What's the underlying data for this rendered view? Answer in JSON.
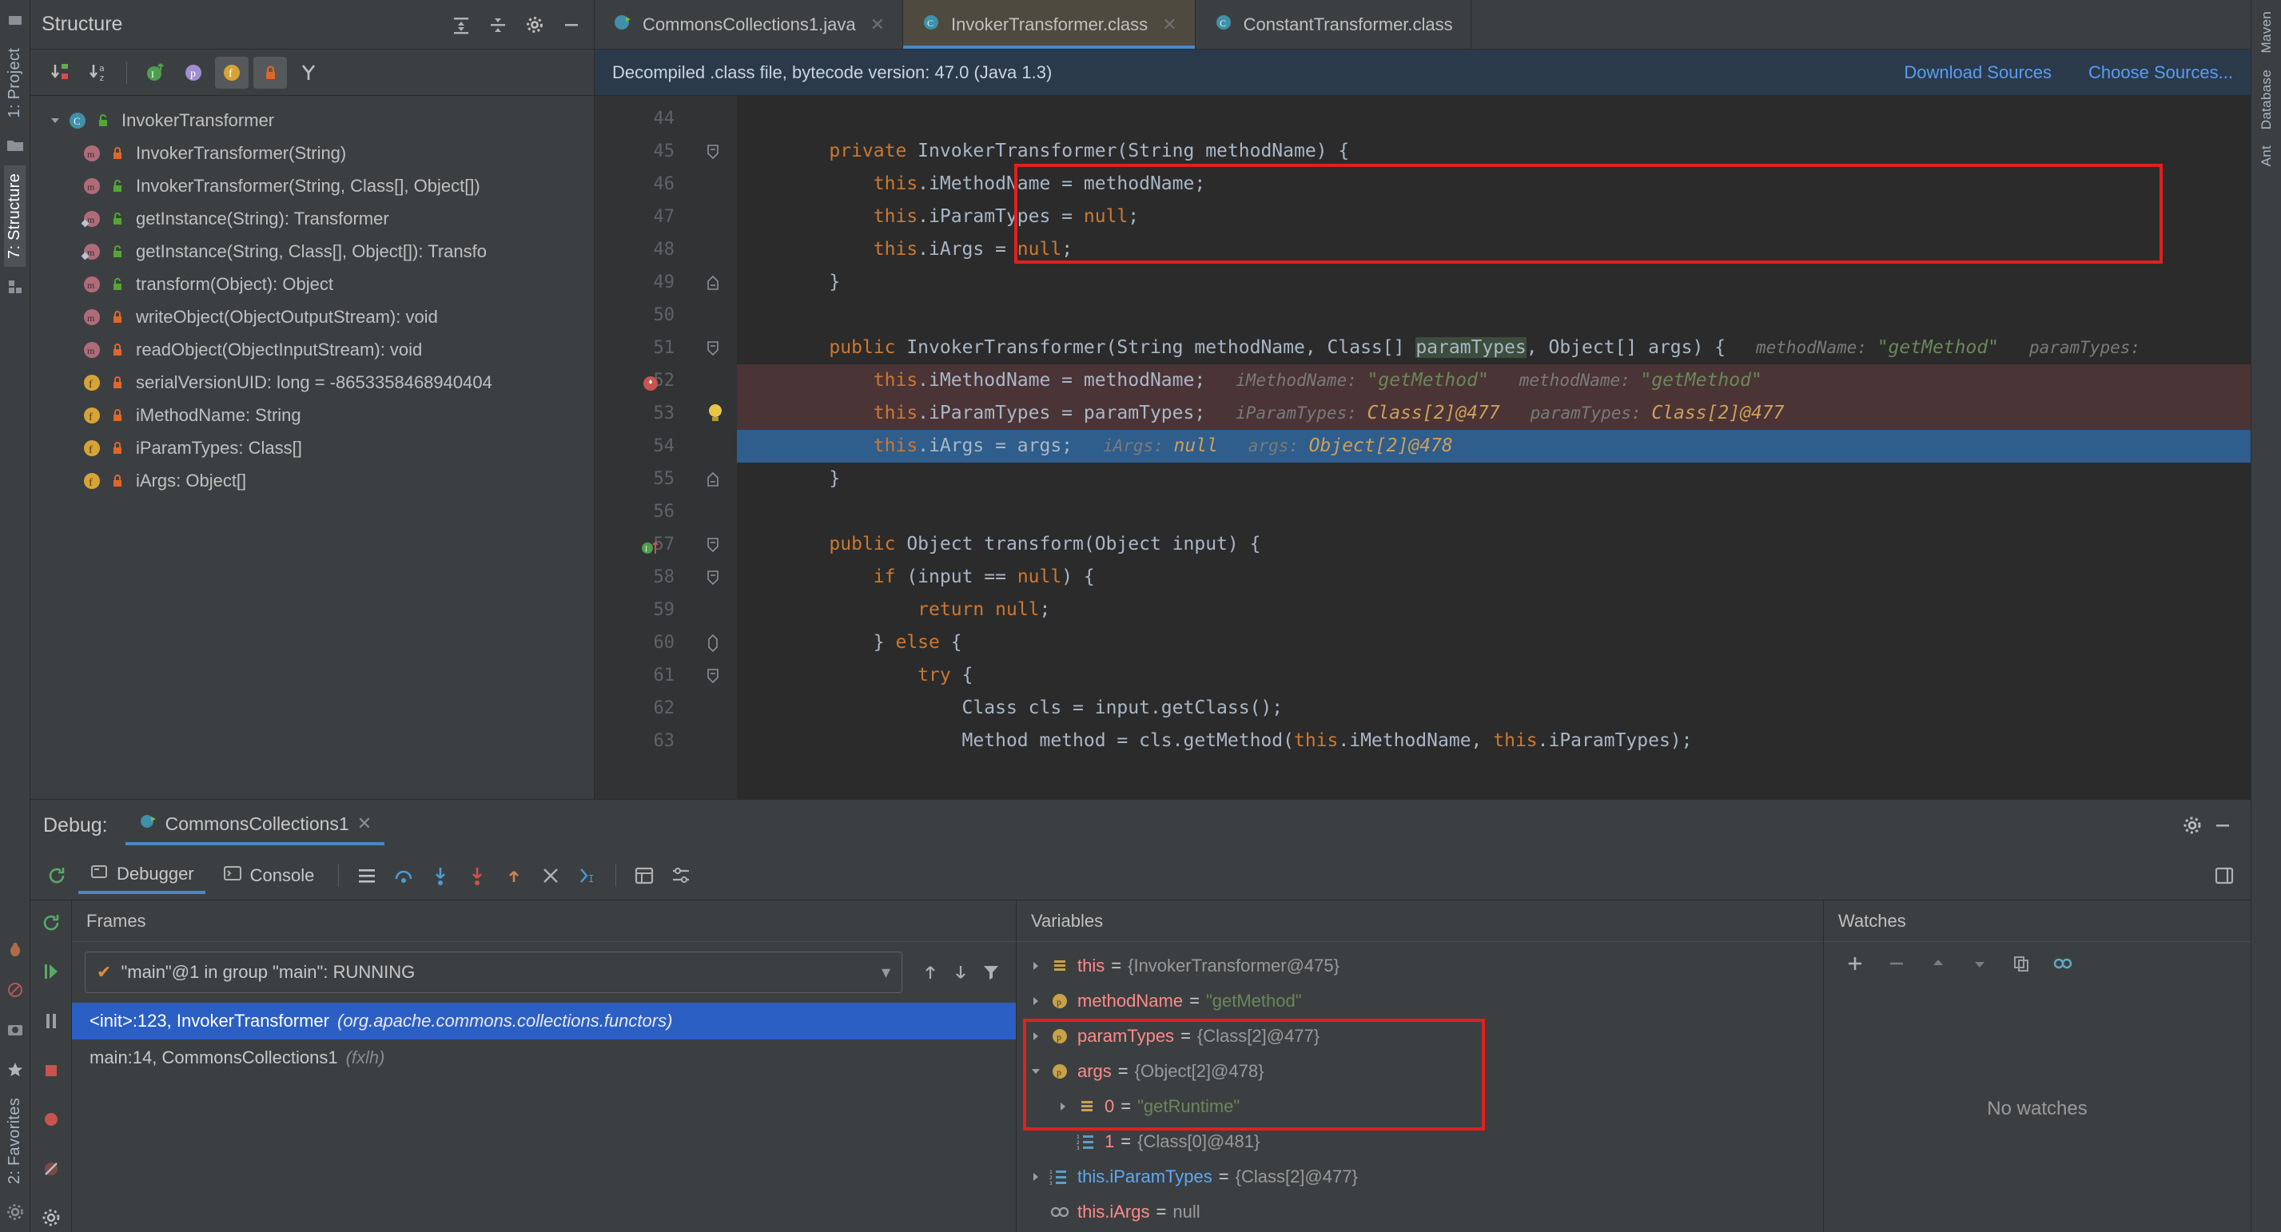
{
  "left_strip": {
    "tabs": [
      {
        "label": "1: Project",
        "icon": "project-icon",
        "active": false
      },
      {
        "label": "7: Structure",
        "icon": "structure-icon",
        "active": true
      },
      {
        "label": "2: Favorites",
        "icon": "favorites-icon",
        "active": false
      }
    ],
    "icons": [
      "folder-icon",
      "grid-icon",
      "bug-icon",
      "run-icon",
      "camera-icon",
      "star-icon",
      "gear-icon"
    ]
  },
  "right_strip": {
    "tabs": [
      "Maven",
      "Database",
      "Ant"
    ]
  },
  "structure": {
    "title": "Structure",
    "header_icons": [
      "expand-all-icon",
      "collapse-all-icon",
      "gear-icon",
      "hide-icon"
    ],
    "toolbar": [
      {
        "name": "sort-by-visibility-button",
        "selected": false
      },
      {
        "name": "sort-alphabetically-button",
        "selected": false
      },
      {
        "name": "show-inherited-button",
        "selected": false
      },
      {
        "name": "show-properties-button",
        "selected": false
      },
      {
        "name": "show-fields-button",
        "selected": true
      },
      {
        "name": "show-non-public-button",
        "selected": true
      },
      {
        "name": "show-anonymous-button",
        "selected": false
      }
    ],
    "tree": [
      {
        "label": "InvokerTransformer",
        "icon": "class-icon",
        "vis": "public-icon",
        "expanded": true,
        "level": 0
      },
      {
        "label": "InvokerTransformer(String)",
        "icon": "method-icon",
        "vis": "private-icon",
        "level": 1
      },
      {
        "label": "InvokerTransformer(String, Class[], Object[])",
        "icon": "method-icon",
        "vis": "public-icon",
        "level": 1
      },
      {
        "label": "getInstance(String): Transformer",
        "icon": "method-static-icon",
        "vis": "public-icon",
        "level": 1
      },
      {
        "label": "getInstance(String, Class[], Object[]): Transfo",
        "icon": "method-static-icon",
        "vis": "public-icon",
        "level": 1
      },
      {
        "label": "transform(Object): Object",
        "icon": "method-icon",
        "vis": "public-icon",
        "level": 1
      },
      {
        "label": "writeObject(ObjectOutputStream): void",
        "icon": "method-icon",
        "vis": "private-icon",
        "level": 1
      },
      {
        "label": "readObject(ObjectInputStream): void",
        "icon": "method-icon",
        "vis": "private-icon",
        "level": 1
      },
      {
        "label": "serialVersionUID: long = -8653358468940404",
        "icon": "field-icon",
        "vis": "private-icon",
        "level": 1
      },
      {
        "label": "iMethodName: String",
        "icon": "field-icon",
        "vis": "private-icon",
        "level": 1
      },
      {
        "label": "iParamTypes: Class[]",
        "icon": "field-icon",
        "vis": "private-icon",
        "level": 1
      },
      {
        "label": "iArgs: Object[]",
        "icon": "field-icon",
        "vis": "private-icon",
        "level": 1
      }
    ]
  },
  "editor": {
    "tabs": [
      {
        "label": "CommonsCollections1.java",
        "icon": "java-file-icon",
        "active": false,
        "closable": true
      },
      {
        "label": "InvokerTransformer.class",
        "icon": "class-file-icon",
        "active": true,
        "closable": true
      },
      {
        "label": "ConstantTransformer.class",
        "icon": "class-file-icon",
        "active": false,
        "closable": true
      }
    ],
    "notice": {
      "message": "Decompiled .class file, bytecode version: 47.0 (Java 1.3)",
      "download_sources": "Download Sources",
      "choose_sources": "Choose Sources..."
    },
    "lines": [
      {
        "no": "44",
        "text": "",
        "fold": "",
        "style": ""
      },
      {
        "no": "45",
        "fold": "end",
        "style": "",
        "tokens": [
          {
            "t": "    ",
            "c": ""
          },
          {
            "t": "private",
            "c": "kw"
          },
          {
            "t": " InvokerTransformer(String methodName) {",
            "c": ""
          }
        ]
      },
      {
        "no": "46",
        "fold": "",
        "style": "",
        "tokens": [
          {
            "t": "        ",
            "c": ""
          },
          {
            "t": "this",
            "c": "kw"
          },
          {
            "t": ".iMethodName = methodName;",
            "c": ""
          }
        ]
      },
      {
        "no": "47",
        "fold": "",
        "style": "",
        "tokens": [
          {
            "t": "        ",
            "c": ""
          },
          {
            "t": "this",
            "c": "kw"
          },
          {
            "t": ".iParamTypes = ",
            "c": ""
          },
          {
            "t": "null",
            "c": "kw"
          },
          {
            "t": ";",
            "c": ""
          }
        ]
      },
      {
        "no": "48",
        "fold": "",
        "style": "",
        "tokens": [
          {
            "t": "        ",
            "c": ""
          },
          {
            "t": "this",
            "c": "kw"
          },
          {
            "t": ".iArgs = ",
            "c": ""
          },
          {
            "t": "null",
            "c": "kw"
          },
          {
            "t": ";",
            "c": ""
          }
        ]
      },
      {
        "no": "49",
        "fold": "start",
        "style": "",
        "tokens": [
          {
            "t": "    }",
            "c": ""
          }
        ]
      },
      {
        "no": "50",
        "text": "",
        "fold": "",
        "style": ""
      },
      {
        "no": "51",
        "fold": "end",
        "style": "",
        "tokens": [
          {
            "t": "    ",
            "c": ""
          },
          {
            "t": "public",
            "c": "kw"
          },
          {
            "t": " InvokerTransformer(String methodName, Class[] ",
            "c": ""
          },
          {
            "t": "paramTypes",
            "c": "param-hl"
          },
          {
            "t": ", Object[] args) {",
            "c": ""
          },
          {
            "t": "   methodName: ",
            "c": "hint"
          },
          {
            "t": "\"getMethod\"",
            "c": "hint-s"
          },
          {
            "t": "   paramTypes:",
            "c": "hint"
          }
        ]
      },
      {
        "no": "52",
        "fold": "",
        "style": "err",
        "breakpoint": true,
        "tokens": [
          {
            "t": "        ",
            "c": ""
          },
          {
            "t": "this",
            "c": "kw"
          },
          {
            "t": ".iMethodName = methodName;",
            "c": ""
          },
          {
            "t": "   iMethodName: ",
            "c": "hint"
          },
          {
            "t": "\"getMethod\"",
            "c": "hint-s"
          },
          {
            "t": "   methodName: ",
            "c": "hint"
          },
          {
            "t": "\"getMethod\"",
            "c": "hint-s"
          }
        ]
      },
      {
        "no": "53",
        "fold": "",
        "style": "err",
        "bulb": true,
        "tokens": [
          {
            "t": "        ",
            "c": ""
          },
          {
            "t": "this",
            "c": "kw"
          },
          {
            "t": ".iParamTypes = paramTypes;",
            "c": ""
          },
          {
            "t": "   iParamTypes: ",
            "c": "hint"
          },
          {
            "t": "Class[2]@477",
            "c": "hint-v"
          },
          {
            "t": "   paramTypes: ",
            "c": "hint"
          },
          {
            "t": "Class[2]@477",
            "c": "hint-v"
          }
        ]
      },
      {
        "no": "54",
        "fold": "",
        "style": "cur",
        "tokens": [
          {
            "t": "        ",
            "c": ""
          },
          {
            "t": "this",
            "c": "kw"
          },
          {
            "t": ".iArgs = args;",
            "c": ""
          },
          {
            "t": "   iArgs: ",
            "c": "hint"
          },
          {
            "t": "null",
            "c": "hint-v"
          },
          {
            "t": "   args: ",
            "c": "hint"
          },
          {
            "t": "Object[2]@478",
            "c": "hint-v"
          }
        ]
      },
      {
        "no": "55",
        "fold": "start",
        "style": "",
        "tokens": [
          {
            "t": "    }",
            "c": ""
          }
        ]
      },
      {
        "no": "56",
        "text": "",
        "fold": "",
        "style": ""
      },
      {
        "no": "57",
        "fold": "end",
        "style": "",
        "marker": "override",
        "tokens": [
          {
            "t": "    ",
            "c": ""
          },
          {
            "t": "public",
            "c": "kw"
          },
          {
            "t": " Object transform(Object input) {",
            "c": ""
          }
        ]
      },
      {
        "no": "58",
        "fold": "end",
        "style": "",
        "tokens": [
          {
            "t": "        ",
            "c": ""
          },
          {
            "t": "if",
            "c": "kw"
          },
          {
            "t": " (input == ",
            "c": ""
          },
          {
            "t": "null",
            "c": "kw"
          },
          {
            "t": ") {",
            "c": ""
          }
        ]
      },
      {
        "no": "59",
        "fold": "",
        "style": "",
        "tokens": [
          {
            "t": "            ",
            "c": ""
          },
          {
            "t": "return",
            "c": "kw"
          },
          {
            "t": " ",
            "c": ""
          },
          {
            "t": "null",
            "c": "kw"
          },
          {
            "t": ";",
            "c": ""
          }
        ]
      },
      {
        "no": "60",
        "fold": "mid",
        "style": "",
        "tokens": [
          {
            "t": "        } ",
            "c": ""
          },
          {
            "t": "else",
            "c": "kw"
          },
          {
            "t": " {",
            "c": ""
          }
        ]
      },
      {
        "no": "61",
        "fold": "end",
        "style": "",
        "tokens": [
          {
            "t": "            ",
            "c": ""
          },
          {
            "t": "try",
            "c": "kw"
          },
          {
            "t": " {",
            "c": ""
          }
        ]
      },
      {
        "no": "62",
        "fold": "",
        "style": "",
        "tokens": [
          {
            "t": "                Class cls = input.getClass();",
            "c": ""
          }
        ]
      },
      {
        "no": "63",
        "fold": "",
        "style": "",
        "tokens": [
          {
            "t": "                Method method = cls.getMethod(",
            "c": ""
          },
          {
            "t": "this",
            "c": "kw"
          },
          {
            "t": ".iMethodName, ",
            "c": ""
          },
          {
            "t": "this",
            "c": "kw"
          },
          {
            "t": ".iParamTypes);",
            "c": ""
          }
        ]
      }
    ]
  },
  "debug": {
    "label": "Debug:",
    "session_tab": "CommonsCollections1",
    "tabs": [
      {
        "label": "Debugger",
        "icon": "debugger-icon",
        "active": true
      },
      {
        "label": "Console",
        "icon": "console-icon",
        "active": false
      }
    ],
    "toolbar_icons": [
      "rerun-icon",
      "resume-icon",
      "pause-icon",
      "stop-icon",
      "mute-breakpoints-icon",
      "view-breakpoints-icon",
      "settings-icon",
      "step-over-icon",
      "step-into-icon",
      "force-step-into-icon",
      "step-out-icon",
      "drop-frame-icon",
      "run-to-cursor-icon",
      "evaluate-icon",
      "layout-icon"
    ],
    "frames": {
      "title": "Frames",
      "thread": "\"main\"@1 in group \"main\": RUNNING",
      "thread_check": "✔",
      "items": [
        {
          "text": "<init>:123, InvokerTransformer",
          "pkg": "(org.apache.commons.collections.functors)",
          "selected": true
        },
        {
          "text": "main:14, CommonsCollections1",
          "pkg": "(fxlh)",
          "selected": false
        }
      ],
      "nav_icons": [
        "up-arrow-icon",
        "down-arrow-icon",
        "filter-icon"
      ]
    },
    "variables": {
      "title": "Variables",
      "rows": [
        {
          "twisty": "collapsed",
          "icon": "object-icon",
          "name": "this",
          "value": "{InvokerTransformer@475}",
          "value_kind": "ref",
          "indent": 0,
          "boxed": false
        },
        {
          "twisty": "collapsed",
          "icon": "param-icon",
          "name": "methodName",
          "value": "\"getMethod\"",
          "value_kind": "string",
          "indent": 0,
          "boxed": false
        },
        {
          "twisty": "collapsed",
          "icon": "param-icon",
          "name": "paramTypes",
          "value": "{Class[2]@477}",
          "value_kind": "ref",
          "indent": 0,
          "boxed": false
        },
        {
          "twisty": "expanded",
          "icon": "param-icon",
          "name": "args",
          "value": "{Object[2]@478}",
          "value_kind": "ref",
          "indent": 0,
          "boxed": true
        },
        {
          "twisty": "collapsed",
          "icon": "object-icon",
          "name": "0",
          "value": "\"getRuntime\"",
          "value_kind": "string",
          "indent": 1,
          "boxed": true
        },
        {
          "twisty": "none",
          "icon": "array-icon",
          "name": "1",
          "value": "{Class[0]@481}",
          "value_kind": "ref",
          "indent": 1,
          "boxed": true
        },
        {
          "twisty": "collapsed",
          "icon": "array-icon",
          "name": "this.iParamTypes",
          "value": "{Class[2]@477}",
          "value_kind": "ref",
          "indent": 0,
          "name_color": "blue",
          "boxed": false
        },
        {
          "twisty": "none",
          "icon": "null-icon",
          "name": "this.iArgs",
          "value": "null",
          "value_kind": "ref",
          "indent": 0,
          "boxed": false
        }
      ]
    },
    "watches": {
      "title": "Watches",
      "empty_text": "No watches",
      "toolbar_icons": [
        "add-icon",
        "remove-icon",
        "up-icon",
        "down-icon",
        "copy-icon",
        "link-icon"
      ]
    }
  },
  "colors": {
    "accent_blue": "#2c5fc4",
    "tab_active": "#4e4a3f",
    "error_red": "#e02020",
    "keyword_orange": "#cc7832",
    "string_green": "#6a8759",
    "notice_bg": "#2b3a4b"
  }
}
